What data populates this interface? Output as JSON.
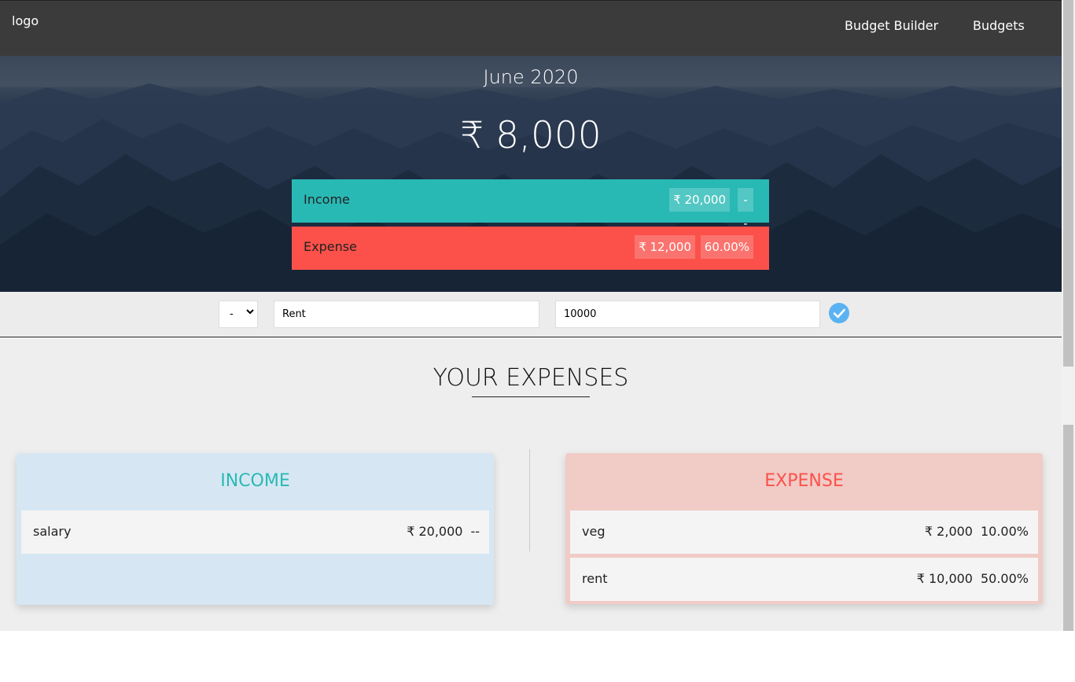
{
  "nav": {
    "logo": "logo",
    "links": [
      "Budget Builder",
      "Budgets"
    ]
  },
  "hero": {
    "month": "June 2020",
    "total": "₹ 8,000",
    "income": {
      "label": "Income",
      "amount": "₹ 20,000",
      "percent": "--"
    },
    "expense": {
      "label": "Expense",
      "amount": "₹ 12,000",
      "percent": "60.00%"
    }
  },
  "add": {
    "type_selected": "-",
    "description": "Rent",
    "value": "10000"
  },
  "section_title": "YOUR EXPENSES",
  "income_panel": {
    "title": "INCOME",
    "items": [
      {
        "name": "salary",
        "amount": "₹ 20,000",
        "percent": "--"
      }
    ]
  },
  "expense_panel": {
    "title": "EXPENSE",
    "items": [
      {
        "name": "veg",
        "amount": "₹ 2,000",
        "percent": "10.00%"
      },
      {
        "name": "rent",
        "amount": "₹ 10,000",
        "percent": "50.00%"
      }
    ]
  },
  "colors": {
    "income": "#29b9b5",
    "expense": "#fb514a",
    "nav": "#3b3b3b",
    "check": "#5bb2f3"
  },
  "icons": {
    "select_chevron": "chevron-down-icon",
    "submit": "check-circle-icon"
  }
}
